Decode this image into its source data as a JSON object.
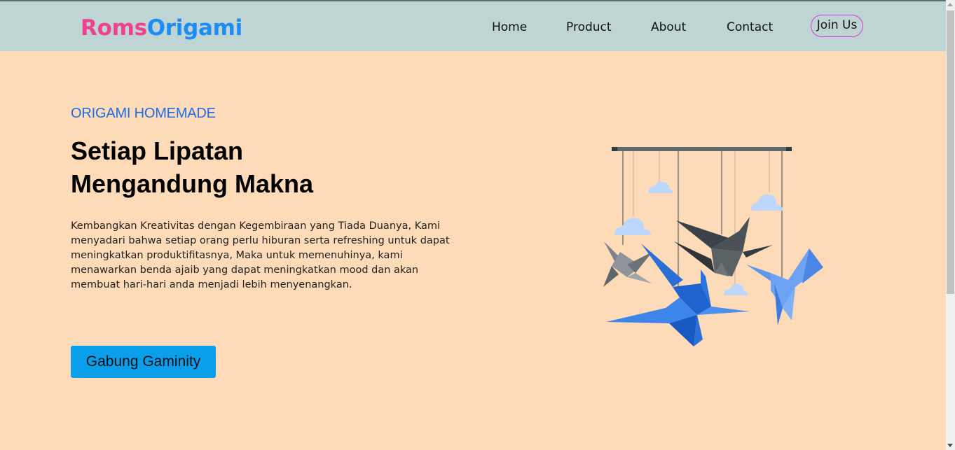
{
  "brand": {
    "part1": "Roms",
    "part2": "Origami"
  },
  "nav": {
    "links": [
      "Home",
      "Product",
      "About",
      "Contact"
    ],
    "join_label": "Join Us"
  },
  "hero": {
    "eyebrow": "ORIGAMI HOMEMADE",
    "headline_line1": "Setiap Lipatan",
    "headline_line2": "Mengandung Makna",
    "description": "Kembangkan Kreativitas dengan Kegembiraan yang Tiada Duanya, Kami menyadari bahwa setiap orang perlu hiburan serta refreshing untuk dapat meningkatkan produktifitasnya, Maka untuk memenuhinya, kami menawarkan benda ajaib yang dapat meningkatkan mood dan akan membuat hari-hari anda menjadi lebih menyenangkan.",
    "cta_label": "Gabung Gaminity"
  },
  "colors": {
    "navbar_bg": "#bed5d4",
    "page_bg": "#fedbb8",
    "brand_pink": "#f0408f",
    "brand_blue": "#1e8cf5",
    "eyebrow_blue": "#1d6ee6",
    "cta_bg": "#0a9eeb",
    "join_border": "#d63fd6"
  },
  "icons": {
    "illustration": "hanging-origami-cranes-mobile"
  }
}
